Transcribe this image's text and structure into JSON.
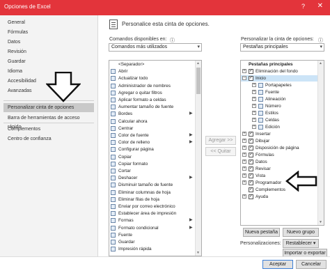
{
  "window": {
    "title": "Opciones de Excel",
    "help": "?",
    "close": "✕"
  },
  "sidebar": {
    "items": [
      "General",
      "Fórmulas",
      "Datos",
      "Revisión",
      "Guardar",
      "Idioma",
      "Accesibilidad",
      "Avanzadas",
      "Personalizar cinta de opciones",
      "Barra de herramientas de acceso rápido",
      "Complementos",
      "Centro de confianza"
    ],
    "selected": "Personalizar cinta de opciones"
  },
  "header": {
    "title": "Personalice esta cinta de opciones."
  },
  "left_panel": {
    "label": "Comandos disponibles en:",
    "info": "ⓘ",
    "dropdown": "Comandos más utilizados",
    "commands": [
      {
        "icon": "",
        "label": "<Separador>",
        "arrow": ""
      },
      {
        "icon": "open-icon",
        "label": "Abrir",
        "arrow": ""
      },
      {
        "icon": "refresh-icon",
        "label": "Actualizar todo",
        "arrow": ""
      },
      {
        "icon": "name-manager-icon",
        "label": "Administrador de nombres",
        "arrow": ""
      },
      {
        "icon": "filter-icon",
        "label": "Agregar o quitar filtros",
        "arrow": ""
      },
      {
        "icon": "format-cells-icon",
        "label": "Aplicar formato a celdas",
        "arrow": ""
      },
      {
        "icon": "font-size-up-icon",
        "label": "Aumentar tamaño de fuente",
        "arrow": ""
      },
      {
        "icon": "borders-icon",
        "label": "Bordes",
        "arrow": "▶"
      },
      {
        "icon": "calculator-icon",
        "label": "Calcular ahora",
        "arrow": ""
      },
      {
        "icon": "center-icon",
        "label": "Centrar",
        "arrow": ""
      },
      {
        "icon": "font-color-icon",
        "label": "Color de fuente",
        "arrow": "▶"
      },
      {
        "icon": "fill-color-icon",
        "label": "Color de relleno",
        "arrow": "▶"
      },
      {
        "icon": "page-setup-icon",
        "label": "Configurar página",
        "arrow": ""
      },
      {
        "icon": "copy-icon",
        "label": "Copiar",
        "arrow": ""
      },
      {
        "icon": "format-painter-icon",
        "label": "Copiar formato",
        "arrow": ""
      },
      {
        "icon": "cut-icon",
        "label": "Cortar",
        "arrow": ""
      },
      {
        "icon": "undo-icon",
        "label": "Deshacer",
        "arrow": "▶"
      },
      {
        "icon": "font-size-down-icon",
        "label": "Disminuir tamaño de fuente",
        "arrow": ""
      },
      {
        "icon": "delete-columns-icon",
        "label": "Eliminar columnas de hoja",
        "arrow": ""
      },
      {
        "icon": "delete-rows-icon",
        "label": "Eliminar filas de hoja",
        "arrow": ""
      },
      {
        "icon": "email-icon",
        "label": "Enviar por correo electrónico",
        "arrow": ""
      },
      {
        "icon": "print-area-icon",
        "label": "Establecer área de impresión",
        "arrow": ""
      },
      {
        "icon": "shapes-icon",
        "label": "Formas",
        "arrow": "▶"
      },
      {
        "icon": "conditional-format-icon",
        "label": "Formato condicional",
        "arrow": "▶"
      },
      {
        "icon": "font-icon",
        "label": "Fuente",
        "arrow": ""
      },
      {
        "icon": "save-icon",
        "label": "Guardar",
        "arrow": ""
      },
      {
        "icon": "quick-print-icon",
        "label": "Impresión rápida",
        "arrow": ""
      }
    ]
  },
  "middle": {
    "add": "Agregar >>",
    "remove": "<< Quitar"
  },
  "right_panel": {
    "label": "Personalizar la cinta de opciones:",
    "info": "ⓘ",
    "dropdown": "Pestañas principales",
    "tree": [
      {
        "exp": "",
        "cb": "",
        "label": "Pestañas principales",
        "bold": true,
        "indent": 0
      },
      {
        "exp": "⊞",
        "cb": "✓",
        "label": "Eliminación del fondo",
        "indent": 0
      },
      {
        "exp": "⊟",
        "cb": "✓",
        "label": "Inicio",
        "indent": 0,
        "highlight": true
      },
      {
        "exp": "⊞",
        "cb": "",
        "label": "Portapapeles",
        "indent": 1
      },
      {
        "exp": "⊞",
        "cb": "",
        "label": "Fuente",
        "indent": 1
      },
      {
        "exp": "⊞",
        "cb": "",
        "label": "Alineación",
        "indent": 1
      },
      {
        "exp": "⊞",
        "cb": "",
        "label": "Número",
        "indent": 1
      },
      {
        "exp": "⊞",
        "cb": "",
        "label": "Estilos",
        "indent": 1
      },
      {
        "exp": "⊞",
        "cb": "",
        "label": "Celdas",
        "indent": 1
      },
      {
        "exp": "⊞",
        "cb": "",
        "label": "Edición",
        "indent": 1
      },
      {
        "exp": "⊞",
        "cb": "✓",
        "label": "Insertar",
        "indent": 0
      },
      {
        "exp": "⊞",
        "cb": "✓",
        "label": "Dibujar",
        "indent": 0
      },
      {
        "exp": "⊞",
        "cb": "✓",
        "label": "Disposición de página",
        "indent": 0
      },
      {
        "exp": "⊞",
        "cb": "✓",
        "label": "Fórmulas",
        "indent": 0
      },
      {
        "exp": "⊞",
        "cb": "✓",
        "label": "Datos",
        "indent": 0
      },
      {
        "exp": "⊞",
        "cb": "✓",
        "label": "Revisar",
        "indent": 0
      },
      {
        "exp": "⊞",
        "cb": "✓",
        "label": "Vista",
        "indent": 0
      },
      {
        "exp": "⊞",
        "cb": "✓",
        "label": "Programador",
        "indent": 0
      },
      {
        "exp": "",
        "cb": "✓",
        "label": "Complementos",
        "indent": 0
      },
      {
        "exp": "⊞",
        "cb": "✓",
        "label": "Ayuda",
        "indent": 0
      }
    ],
    "new_tab": "Nueva pestaña",
    "new_group": "Nuevo grupo",
    "custom_label": "Personalizaciones:",
    "reset": "Restablecer ▾",
    "import_export": "Importar o exportar ▾"
  },
  "footer": {
    "ok": "Aceptar",
    "cancel": "Cancelar"
  },
  "colors": {
    "titlebar": "#e3343b",
    "selected": "#c9c9c9",
    "highlight": "#cce4f7"
  }
}
